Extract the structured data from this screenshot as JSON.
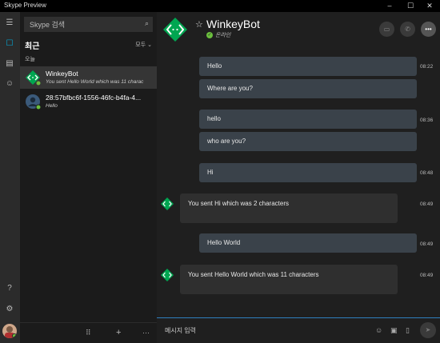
{
  "window": {
    "title": "Skype Preview",
    "min": "–",
    "max": "☐",
    "close": "✕"
  },
  "rail": {
    "menu": "☰",
    "recent": "☐",
    "contacts": "▤",
    "people": "☺",
    "help": "?",
    "settings": "⚙"
  },
  "search": {
    "placeholder": "Skype 검색",
    "icon": "⌕"
  },
  "recent_label": "최근",
  "filter_label": "모두 ⌄",
  "day_label": "오늘",
  "conversations": [
    {
      "name": "WinkeyBot",
      "preview": "You sent Hello World which was 11 charac",
      "selected": true
    },
    {
      "name": "28:57bfbc6f-1556-46fc-b4fa-4...",
      "preview": "Hello",
      "selected": false
    }
  ],
  "list_footer": {
    "dialpad": "⠿",
    "add": "+",
    "more": "···"
  },
  "header": {
    "name": "WinkeyBot",
    "status": "온라인",
    "star": "☆",
    "video": "▭",
    "call": "✆",
    "more": "•••"
  },
  "messages": [
    {
      "text": "Hello",
      "time": "08:22"
    },
    {
      "text": "Where are you?"
    },
    {
      "text": "hello",
      "time": "08:36"
    },
    {
      "text": "who are you?"
    },
    {
      "text": "Hi",
      "time": "08:48"
    },
    {
      "text": "You sent Hi which was 2 characters",
      "time": "08:49"
    },
    {
      "text": "Hello World",
      "time": "08:49"
    },
    {
      "text": "You sent Hello World which was 11 characters",
      "time": "08:49"
    }
  ],
  "composer": {
    "placeholder": "메시지 입력",
    "emoji": "☺",
    "image": "▣",
    "file": "▯",
    "send": "➤"
  },
  "colors": {
    "bot_green": "#00a651",
    "accent": "#00b2e3",
    "online": "#6bbf3e"
  }
}
